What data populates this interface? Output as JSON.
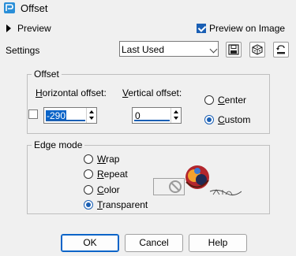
{
  "window": {
    "title": "Offset"
  },
  "header": {
    "preview_label": "Preview",
    "preview_on_image_label": "Preview on Image",
    "preview_on_image_checked": true
  },
  "settings": {
    "label": "Settings",
    "selected": "Last Used"
  },
  "offset_group": {
    "title": "Offset",
    "horizontal_label": "Horizontal offset:",
    "horizontal_value": "-290",
    "vertical_label": "Vertical offset:",
    "vertical_value": "0",
    "center_label": "Center",
    "custom_label": "Custom",
    "selected": "Custom"
  },
  "edge_group": {
    "title": "Edge mode",
    "options": [
      "Wrap",
      "Repeat",
      "Color",
      "Transparent"
    ],
    "selected": "Transparent"
  },
  "buttons": {
    "ok": "OK",
    "cancel": "Cancel",
    "help": "Help"
  }
}
